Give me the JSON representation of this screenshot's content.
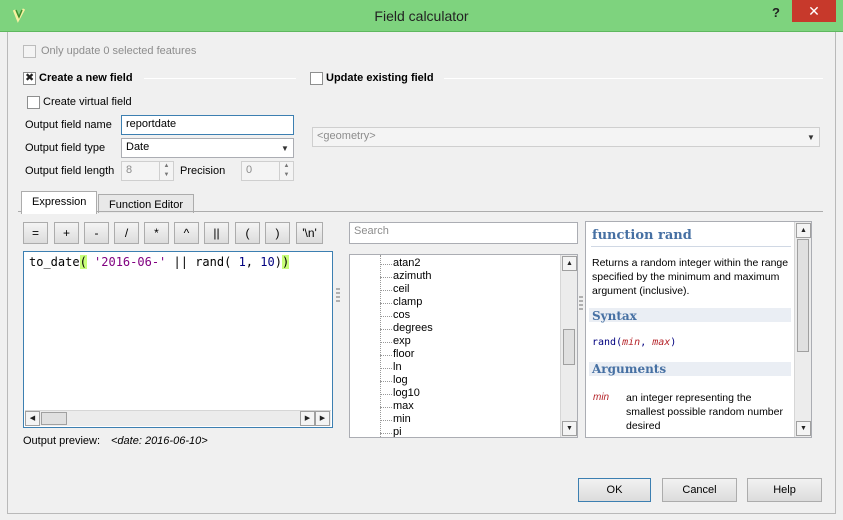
{
  "window": {
    "title": "Field calculator",
    "help_glyph": "?",
    "close_glyph": "✕"
  },
  "options": {
    "only_update_label": "Only update 0 selected features",
    "create_new_field_label": "Create a new field",
    "update_existing_label": "Update existing field",
    "create_virtual_label": "Create virtual field",
    "output_field_name_label": "Output field name",
    "output_field_name_value": "reportdate",
    "output_field_type_label": "Output field type",
    "output_field_type_value": "Date",
    "output_field_length_label": "Output field length",
    "output_field_length_value": "8",
    "precision_label": "Precision",
    "precision_value": "0",
    "geometry_combo_value": "<geometry>"
  },
  "tabs": {
    "expression": "Expression",
    "function_editor": "Function Editor"
  },
  "operators": [
    "=",
    "+",
    "-",
    "/",
    "*",
    "^",
    "||",
    "(",
    ")",
    "'\\n'"
  ],
  "expression": {
    "fn": "to_date",
    "open1": "(",
    "str": " '2016-06-'",
    "op": " || ",
    "fn2": "rand",
    "open2": "(",
    "n1": " 1",
    "comma": ",",
    "n2": " 10",
    "close2": ")",
    "close1": ")"
  },
  "search": {
    "placeholder": "Search"
  },
  "functions": [
    "atan2",
    "azimuth",
    "ceil",
    "clamp",
    "cos",
    "degrees",
    "exp",
    "floor",
    "ln",
    "log",
    "log10",
    "max",
    "min",
    "pi"
  ],
  "help": {
    "title": "function rand",
    "description": "Returns a random integer within the range specified by the minimum and maximum argument (inclusive).",
    "syntax_heading": "Syntax",
    "syntax_fn": "rand",
    "syntax_open": "(",
    "syntax_arg1": "min",
    "syntax_sep": ", ",
    "syntax_arg2": "max",
    "syntax_close": ")",
    "arguments_heading": "Arguments",
    "arg_name": "min",
    "arg_desc": "an integer representing the smallest possible random number desired"
  },
  "preview": {
    "label": "Output preview:",
    "value": "<date: 2016-06-10>"
  },
  "buttons": {
    "ok": "OK",
    "cancel": "Cancel",
    "help": "Help"
  }
}
